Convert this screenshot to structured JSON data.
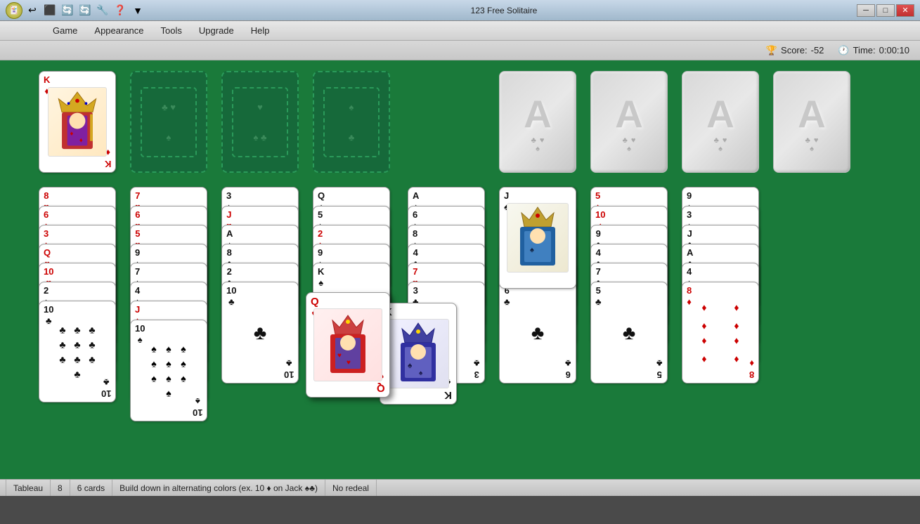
{
  "titlebar": {
    "title": "123 Free Solitaire",
    "minimize": "─",
    "maximize": "□",
    "close": "✕"
  },
  "menubar": {
    "items": [
      "Game",
      "Appearance",
      "Tools",
      "Upgrade",
      "Help"
    ]
  },
  "scorebar": {
    "score_label": "Score:",
    "score_value": "-52",
    "time_label": "Time:",
    "time_value": "0:00:10"
  },
  "statusbar": {
    "type": "Tableau",
    "columns": "8",
    "cards": "6 cards",
    "rule": "Build down in alternating colors (ex. 10 ♦ on Jack ♠♣)",
    "redeal": "No redeal"
  }
}
